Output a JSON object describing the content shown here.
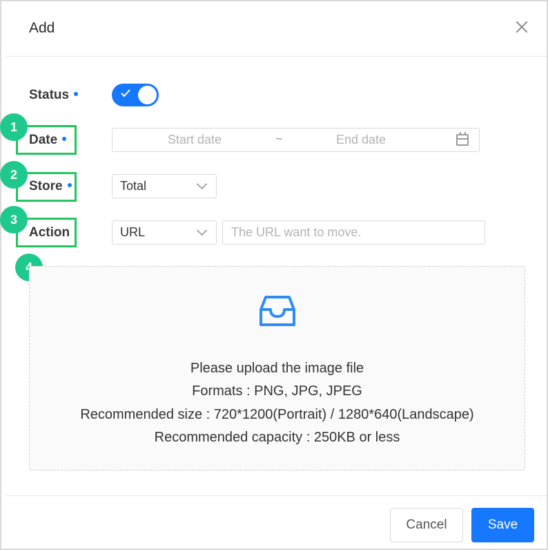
{
  "dialog": {
    "title": "Add"
  },
  "form": {
    "status": {
      "label": "Status",
      "enabled": true
    },
    "date": {
      "label": "Date",
      "start_placeholder": "Start date",
      "separator": "~",
      "end_placeholder": "End date"
    },
    "store": {
      "label": "Store",
      "value": "Total"
    },
    "action": {
      "label": "Action",
      "value": "URL",
      "url_placeholder": "The URL want to move."
    }
  },
  "badges": [
    "1",
    "2",
    "3",
    "4"
  ],
  "upload": {
    "icon": "inbox-icon",
    "line1": "Please upload the image file",
    "line2": "Formats : PNG, JPG, JPEG",
    "line3": "Recommended size : 720*1200(Portrait) / 1280*640(Landscape)",
    "line4": "Recommended capacity : 250KB or less"
  },
  "footer": {
    "cancel": "Cancel",
    "save": "Save"
  },
  "colors": {
    "primary": "#1677ff",
    "highlight": "#22c55e",
    "badge": "#1fc98e",
    "required_dot": "#1677ff"
  }
}
